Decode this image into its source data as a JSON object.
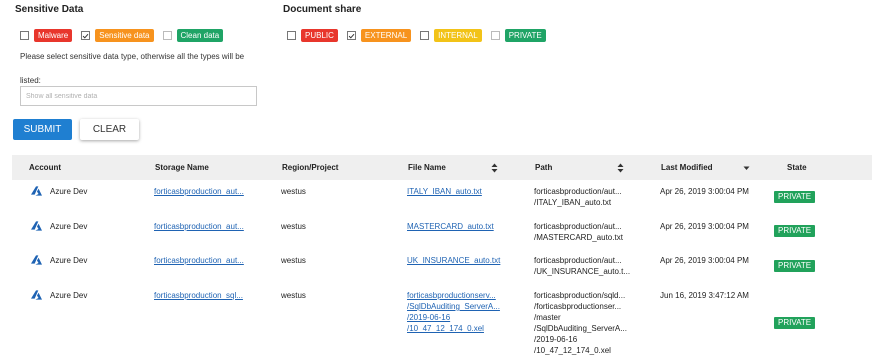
{
  "sensitive": {
    "title": "Sensitive Data",
    "filters": [
      {
        "label": "Malware",
        "checked": false,
        "color": "#e8362c"
      },
      {
        "label": "Sensitive data",
        "checked": true,
        "color": "#f7931e"
      },
      {
        "label": "Clean data",
        "checked": false,
        "color": "#1fa466"
      }
    ],
    "help_text": "Please select sensitive data type, otherwise all the types will be listed:",
    "input_placeholder": "Show all sensitive data"
  },
  "share": {
    "title": "Document share",
    "filters": [
      {
        "label": "PUBLIC",
        "checked": false,
        "color": "#e8362c"
      },
      {
        "label": "EXTERNAL",
        "checked": true,
        "color": "#f7931e"
      },
      {
        "label": "INTERNAL",
        "checked": false,
        "color": "#f2c318"
      },
      {
        "label": "PRIVATE",
        "checked": false,
        "color": "#1fa466"
      }
    ]
  },
  "buttons": {
    "submit": "SUBMIT",
    "clear": "CLEAR"
  },
  "table": {
    "headers": {
      "account": "Account",
      "storage": "Storage Name",
      "region": "Region/Project",
      "file": "File Name",
      "path": "Path",
      "modified": "Last Modified",
      "state": "State"
    },
    "rows": [
      {
        "account": "Azure Dev",
        "storage": "forticasbproduction_aut...",
        "region": "westus",
        "file": [
          "ITALY_IBAN_auto.txt"
        ],
        "path": [
          "forticasbproduction/aut...",
          "/ITALY_IBAN_auto.txt"
        ],
        "modified": "Apr 26, 2019 3:00:04 PM",
        "state": "PRIVATE"
      },
      {
        "account": "Azure Dev",
        "storage": "forticasbproduction_aut...",
        "region": "westus",
        "file": [
          "MASTERCARD_auto.txt"
        ],
        "path": [
          "forticasbproduction/aut...",
          "/MASTERCARD_auto.txt"
        ],
        "modified": "Apr 26, 2019 3:00:04 PM",
        "state": "PRIVATE"
      },
      {
        "account": "Azure Dev",
        "storage": "forticasbproduction_aut...",
        "region": "westus",
        "file": [
          "UK_INSURANCE_auto.txt"
        ],
        "path": [
          "forticasbproduction/aut...",
          "/UK_INSURANCE_auto.t..."
        ],
        "modified": "Apr 26, 2019 3:00:04 PM",
        "state": "PRIVATE"
      },
      {
        "account": "Azure Dev",
        "storage": "forticasbproduction_sql...",
        "region": "westus",
        "file": [
          "forticasbproductionserv...",
          "/SqlDbAuditing_ServerA...",
          "/2019-06-16",
          "/10_47_12_174_0.xel"
        ],
        "path": [
          "forticasbproduction/sqld...",
          "/forticasbproductionser...",
          "/master",
          "/SqlDbAuditing_ServerA...",
          "/2019-06-16",
          "/10_47_12_174_0.xel"
        ],
        "modified": "Jun 16, 2019 3:47:12 AM",
        "state": "PRIVATE"
      }
    ]
  },
  "icons": {
    "checkbox_checked": "check-icon",
    "account": "azure-icon",
    "sort": "sort-icon",
    "sort_desc": "sort-desc-icon"
  },
  "colors": {
    "submit": "#1f7fd1",
    "link": "#1f63b3",
    "state_private": "#21a25b"
  }
}
